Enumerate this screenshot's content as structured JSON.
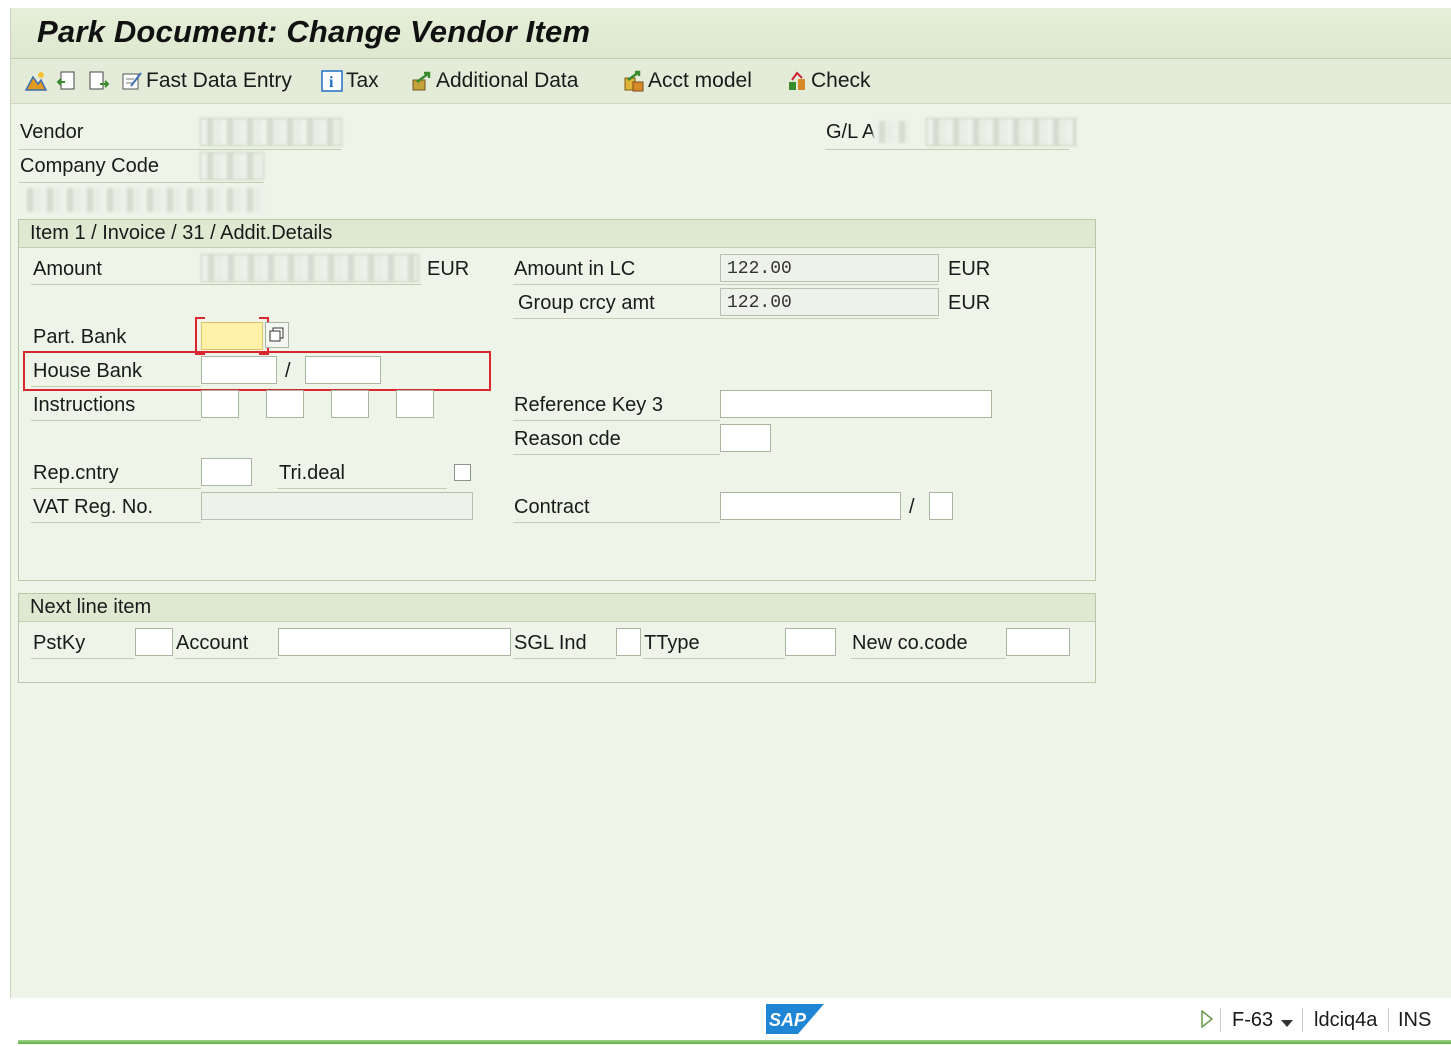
{
  "title": "Park Document: Change Vendor Item",
  "toolbar": {
    "fast_data_entry": "Fast Data Entry",
    "tax": "Tax",
    "additional_data": "Additional Data",
    "acct_model": "Acct model",
    "check": "Check"
  },
  "header": {
    "vendor_label": "Vendor",
    "company_code_label": "Company Code",
    "gl_label": "G/L A"
  },
  "item_group": {
    "title": "Item 1 / Invoice / 31 / Addit.Details",
    "amount_label": "Amount",
    "amount_currency": "EUR",
    "amount_lc_label": "Amount in LC",
    "amount_lc_value": "122.00",
    "amount_lc_currency": "EUR",
    "group_crcy_label": "Group crcy amt",
    "group_crcy_value": "122.00",
    "group_crcy_currency": "EUR",
    "part_bank_label": "Part. Bank",
    "house_bank_label": "House Bank",
    "house_bank_sep": "/",
    "instructions_label": "Instructions",
    "reference_key3_label": "Reference Key 3",
    "reason_code_label": "Reason cde",
    "rep_cntry_label": "Rep.cntry",
    "tri_deal_label": "Tri.deal",
    "vat_reg_label": "VAT Reg. No.",
    "contract_label": "Contract",
    "contract_sep": "/"
  },
  "next_group": {
    "title": "Next line item",
    "pstky_label": "PstKy",
    "account_label": "Account",
    "sgl_ind_label": "SGL Ind",
    "ttype_label": "TType",
    "new_cocode_label": "New co.code"
  },
  "status": {
    "transaction": "F-63",
    "server": "ldciq4a",
    "mode": "INS"
  },
  "colors": {
    "background": "#eef4e8",
    "group_header": "#dfe9d2",
    "highlight_box": "#d9262e",
    "required_field": "#fff1a8",
    "sap_logo": "#1f86d6"
  }
}
